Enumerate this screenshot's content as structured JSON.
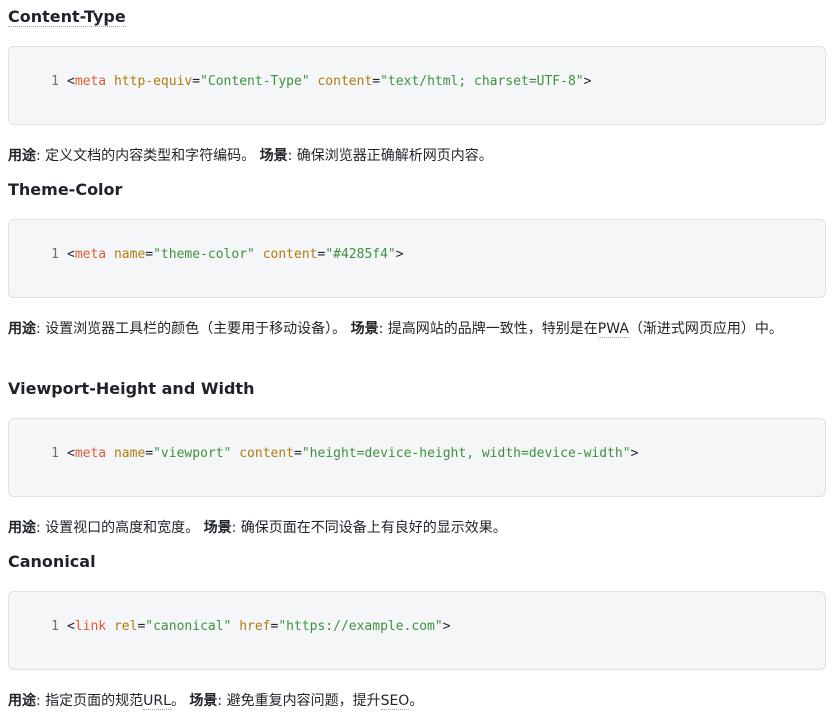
{
  "sections": [
    {
      "title": "Content-Type",
      "code": {
        "line_no": "1",
        "lt": "<",
        "tag": "meta",
        "attr1": "http-equiv",
        "val1": "\"Content-Type\"",
        "attr2": "content",
        "val2": "\"text/html; charset=UTF-8\"",
        "gt": ">"
      },
      "use_label": "用途",
      "use_text": ": 定义文档的内容类型和字符编码。 ",
      "scene_label": "场景",
      "scene_text": ": 确保浏览器正确解析网页内容。"
    },
    {
      "title": "Theme-Color",
      "code": {
        "line_no": "1",
        "lt": "<",
        "tag": "meta",
        "attr1": "name",
        "val1": "\"theme-color\"",
        "attr2": "content",
        "val2": "\"#4285f4\"",
        "gt": ">"
      },
      "use_label": "用途",
      "use_text": ": 设置浏览器工具栏的颜色（主要用于移动设备）。 ",
      "scene_label": "场景",
      "scene_text_a": ": 提高网站的品牌一致性，特别是在",
      "scene_link": "PWA",
      "scene_text_b": "（渐进式网页应用）中。"
    },
    {
      "title": "Viewport-Height and Width",
      "code": {
        "line_no": "1",
        "lt": "<",
        "tag": "meta",
        "attr1": "name",
        "val1": "\"viewport\"",
        "attr2": "content",
        "val2": "\"height=device-height, width=device-width\"",
        "gt": ">"
      },
      "use_label": "用途",
      "use_text": ": 设置视口的高度和宽度。 ",
      "scene_label": "场景",
      "scene_text": ": 确保页面在不同设备上有良好的显示效果。"
    },
    {
      "title": "Canonical",
      "code": {
        "line_no": "1",
        "lt": "<",
        "tag": "link",
        "attr1": "rel",
        "val1": "\"canonical\"",
        "attr2": "href",
        "val2": "\"https://example.com\"",
        "gt": ">"
      },
      "use_label": "用途",
      "use_text_a": ": 指定页面的规范",
      "use_link": "URL",
      "use_text_b": "。 ",
      "scene_label": "场景",
      "scene_text_a": ": 避免重复内容问题，提升",
      "scene_link": "SEO",
      "scene_text_b": "。"
    }
  ]
}
